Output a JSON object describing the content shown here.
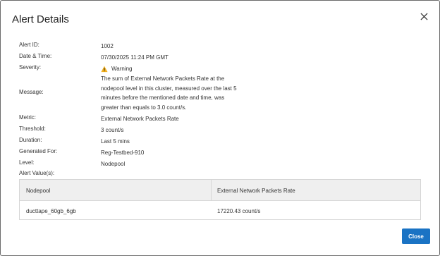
{
  "dialog": {
    "title": "Alert Details",
    "close_label": "Close"
  },
  "fields": {
    "alert_id": {
      "label": "Alert ID:",
      "value": "1002"
    },
    "date_time": {
      "label": "Date & Time:",
      "value": "07/30/2025 11:24 PM GMT"
    },
    "severity": {
      "label": "Severity:",
      "value": "Warning"
    },
    "message": {
      "label": "Message:",
      "lines": [
        "The sum of External Network Packets Rate at the",
        "nodepool level in this cluster, measured over the last 5",
        "minutes before the mentioned date and time, was",
        "greater than equals to 3.0 count/s."
      ]
    },
    "metric": {
      "label": "Metric:",
      "value": "External Network Packets Rate"
    },
    "threshold": {
      "label": "Threshold:",
      "value": "3 count/s"
    },
    "duration": {
      "label": "Duration:",
      "value": "Last 5 mins"
    },
    "generated_for": {
      "label": "Generated For:",
      "value": "Reg-Testbed-910"
    },
    "level": {
      "label": "Level:",
      "value": "Nodepool"
    },
    "alert_values": {
      "label": "Alert Value(s):"
    }
  },
  "table": {
    "headers": [
      "Nodepool",
      "External Network Packets Rate"
    ],
    "rows": [
      [
        "ducttape_60gb_6gb",
        "17220.43 count/s"
      ]
    ]
  },
  "colors": {
    "primary_button": "#1a73c4",
    "warning_icon": "#f2b01e"
  },
  "icons": {
    "close": "close-icon",
    "severity": "warning-triangle-icon"
  }
}
